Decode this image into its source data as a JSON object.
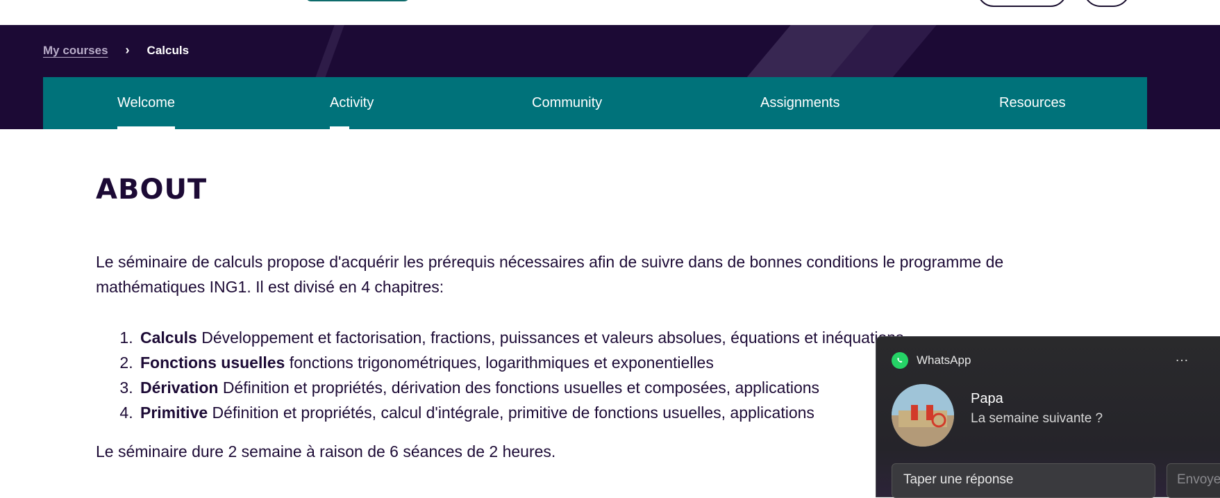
{
  "breadcrumb": {
    "parent": "My courses",
    "separator": "›",
    "current": "Calculs"
  },
  "tabs": [
    {
      "label": "Welcome",
      "active": true
    },
    {
      "label": "Activity",
      "active": false
    },
    {
      "label": "Community",
      "active": false
    },
    {
      "label": "Assignments",
      "active": false
    },
    {
      "label": "Resources",
      "active": false
    }
  ],
  "about": {
    "title": "ABOUT",
    "intro": "Le séminaire de calculs propose d'acquérir les prérequis nécessaires afin de suivre dans de bonnes conditions le programme de mathématiques ING1. Il est divisé en 4 chapitres:",
    "chapters": [
      {
        "name": "Calculs",
        "desc": "Développement et factorisation, fractions, puissances et valeurs absolues, équations et inéquations"
      },
      {
        "name": "Fonctions usuelles",
        "desc": "fonctions trigonométriques, logarithmiques et exponentielles"
      },
      {
        "name": "Dérivation",
        "desc": "Définition et propriétés, dérivation des fonctions usuelles et composées, applications"
      },
      {
        "name": "Primitive",
        "desc": "Définition et propriétés, calcul d'intégrale, primitive de fonctions usuelles, applications"
      }
    ],
    "duration": "Le séminaire dure 2 semaine à raison de 6 séances de 2 heures."
  },
  "notification": {
    "app_name": "WhatsApp",
    "more_icon": "…",
    "sender": "Papa",
    "message": "La semaine suivante ?",
    "reply_placeholder": "Taper une réponse",
    "send_label": "Envoyer"
  },
  "colors": {
    "banner": "#1c0a35",
    "tab_bar": "#00727a",
    "text": "#1c0a35",
    "whatsapp_green": "#25d366"
  }
}
